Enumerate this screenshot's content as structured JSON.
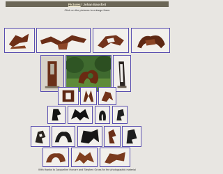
{
  "header": {
    "nav_link": "Pictures",
    "separator": " / ",
    "artist": "Johan Bassfort"
  },
  "instructions": "Click on the pictures to enlarge them",
  "footer": "With thanks to Jacqueline Honore and Stephen Gross for the photographic material",
  "colors": {
    "title_bar": "#6b6656",
    "thumb_border": "#5a4fb0",
    "page_bg": "#e8e6e2",
    "sculpture_rust": "#7a3a1e"
  }
}
